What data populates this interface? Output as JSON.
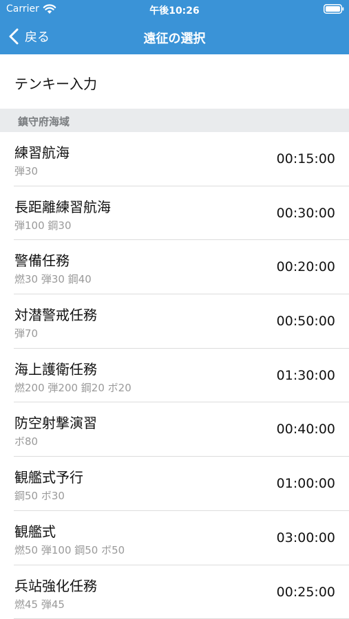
{
  "status_bar": {
    "carrier": "Carrier",
    "time": "午後10:26"
  },
  "nav": {
    "back_label": "戻る",
    "title": "遠征の選択"
  },
  "tenkey": {
    "label": "テンキー入力"
  },
  "section": {
    "header": "鎮守府海域"
  },
  "missions": [
    {
      "name": "練習航海",
      "resources": "弾30",
      "duration": "00:15:00"
    },
    {
      "name": "長距離練習航海",
      "resources": "弾100 鋼30",
      "duration": "00:30:00"
    },
    {
      "name": "警備任務",
      "resources": "燃30 弾30 鋼40",
      "duration": "00:20:00"
    },
    {
      "name": "対潜警戒任務",
      "resources": "弾70",
      "duration": "00:50:00"
    },
    {
      "name": "海上護衛任務",
      "resources": "燃200 弾200 鋼20 ボ20",
      "duration": "01:30:00"
    },
    {
      "name": "防空射撃演習",
      "resources": "ボ80",
      "duration": "00:40:00"
    },
    {
      "name": "観艦式予行",
      "resources": "鋼50 ボ30",
      "duration": "01:00:00"
    },
    {
      "name": "観艦式",
      "resources": "燃50 弾100 鋼50 ボ50",
      "duration": "03:00:00"
    },
    {
      "name": "兵站強化任務",
      "resources": "燃45 弾45",
      "duration": "00:25:00"
    }
  ],
  "colors": {
    "nav_background": "#3a93d7",
    "section_background": "#e9ebed"
  },
  "icons": {
    "back": "chevron-left-icon",
    "wifi": "wifi-icon",
    "battery": "battery-icon"
  }
}
